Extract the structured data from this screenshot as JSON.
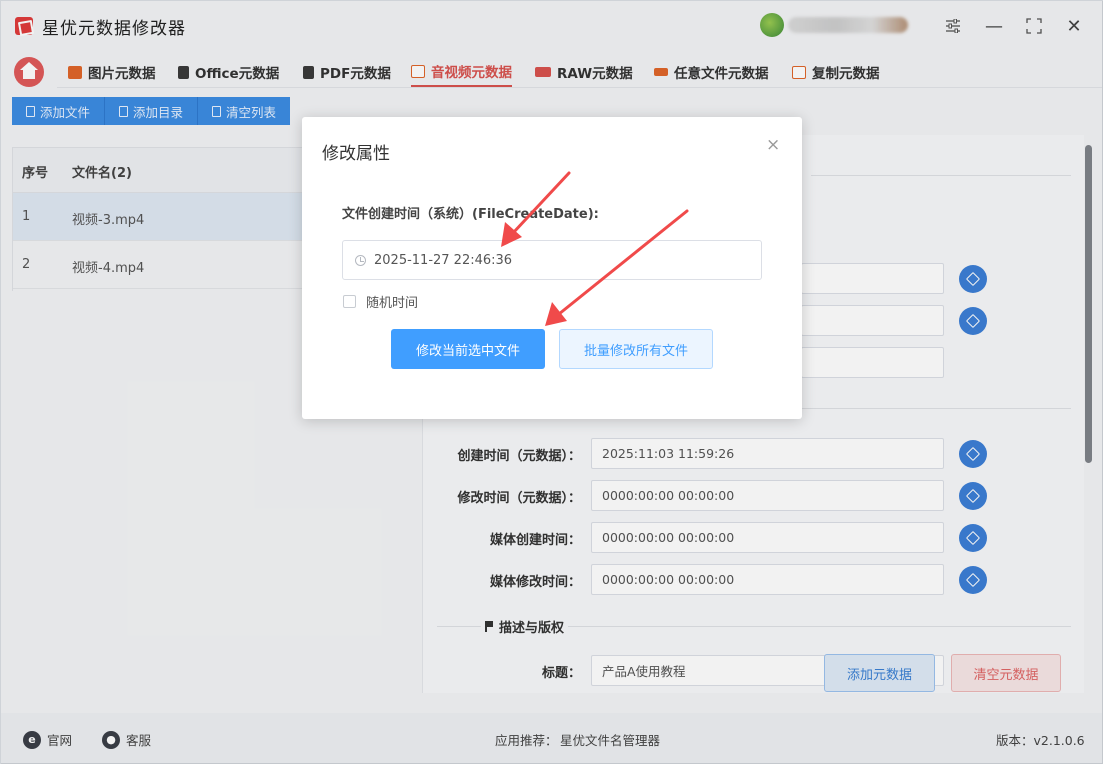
{
  "app": {
    "title": "星优元数据修改器",
    "colors": {
      "accent": "#409eff",
      "brand_red": "#d9534f",
      "toolbar_blue": "#3d8de3"
    }
  },
  "window_controls": {
    "settings_icon": "sliders-icon",
    "minimize": "—",
    "maximize": "⛶",
    "close": "✕"
  },
  "tabs": [
    {
      "label": "图片元数据",
      "icon": "image-icon",
      "color": "#e0662a"
    },
    {
      "label": "Office元数据",
      "icon": "office-icon",
      "color": "#3a3a3a"
    },
    {
      "label": "PDF元数据",
      "icon": "pdf-icon",
      "color": "#3a3a3a"
    },
    {
      "label": "音视频元数据",
      "icon": "video-icon",
      "color": "#e0662a",
      "active": true
    },
    {
      "label": "RAW元数据",
      "icon": "raw-icon",
      "color": "#d9534f"
    },
    {
      "label": "任意文件元数据",
      "icon": "file-icon",
      "color": "#e0662a"
    },
    {
      "label": "复制元数据",
      "icon": "copy-icon",
      "color": "#e0662a"
    }
  ],
  "toolbar": {
    "add_file": "添加文件",
    "add_dir": "添加目录",
    "clear_list": "清空列表"
  },
  "file_list": {
    "col_index": "序号",
    "col_name": "文件名(2)",
    "rows": [
      {
        "index": "1",
        "name": "视频-3.mp4",
        "selected": true
      },
      {
        "index": "2",
        "name": "视频-4.mp4",
        "selected": false
      }
    ]
  },
  "metadata": {
    "fields": [
      {
        "label": "创建时间（元数据）：",
        "value": "2025:11:03 11:59:26"
      },
      {
        "label": "修改时间（元数据）：",
        "value": "0000:00:00 00:00:00"
      },
      {
        "label": "媒体创建时间：",
        "value": "0000:00:00 00:00:00"
      },
      {
        "label": "媒体修改时间：",
        "value": "0000:00:00 00:00:00"
      }
    ],
    "section_desc": "描述与版权",
    "title_label": "标题：",
    "title_value": "产品A使用教程",
    "add_button": "添加元数据",
    "clear_button": "清空元数据"
  },
  "modal": {
    "title": "修改属性",
    "close": "×",
    "field_label": "文件创建时间（系统）(FileCreateDate):",
    "date_value": "2025-11-27 22:46:36",
    "random_time_label": "随机时间",
    "random_time_checked": false,
    "modify_current": "修改当前选中文件",
    "modify_all": "批量修改所有文件"
  },
  "statusbar": {
    "website": "官网",
    "support": "客服",
    "recommend_label": "应用推荐：",
    "recommend_app": "星优文件名管理器",
    "version": "版本：v2.1.0.6"
  }
}
